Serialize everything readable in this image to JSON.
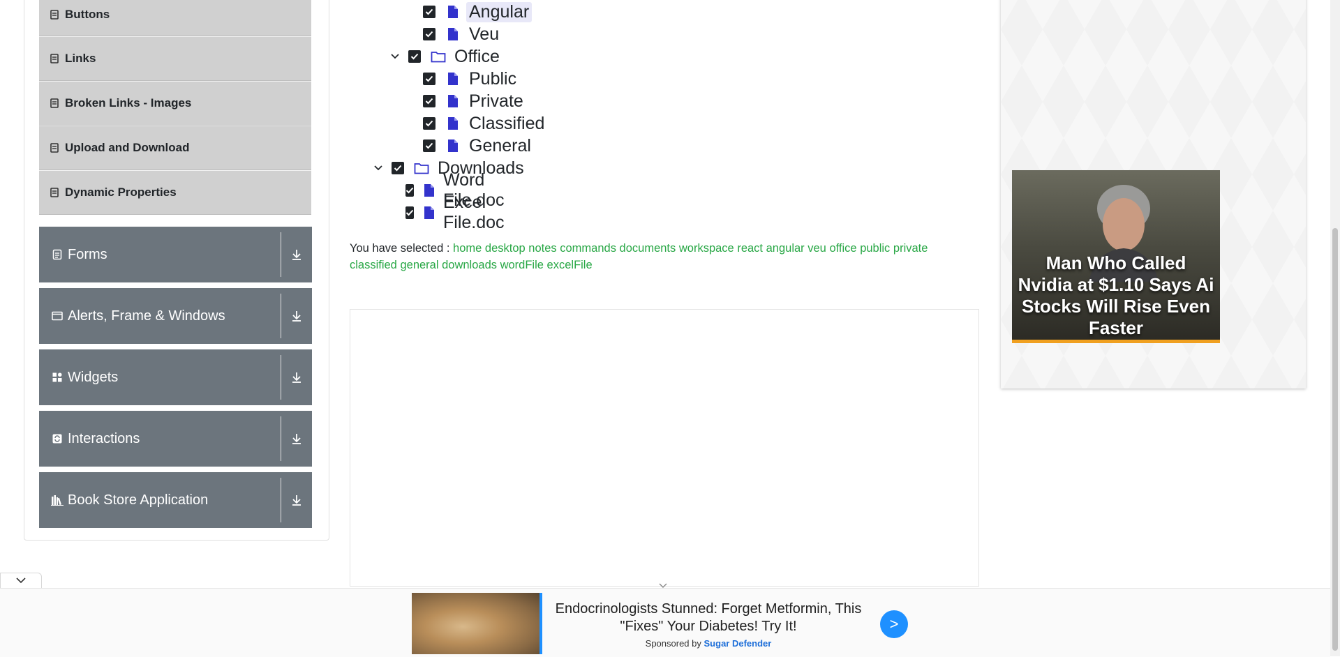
{
  "sidebar": {
    "sub_items": [
      {
        "label": "Buttons",
        "icon": "list-icon"
      },
      {
        "label": "Links",
        "icon": "list-icon"
      },
      {
        "label": "Broken Links - Images",
        "icon": "list-icon"
      },
      {
        "label": "Upload and Download",
        "icon": "list-icon"
      },
      {
        "label": "Dynamic Properties",
        "icon": "list-icon"
      }
    ],
    "groups": [
      {
        "label": "Forms",
        "icon": "document-icon"
      },
      {
        "label": "Alerts, Frame & Windows",
        "icon": "window-icon"
      },
      {
        "label": "Widgets",
        "icon": "grid-icon"
      },
      {
        "label": "Interactions",
        "icon": "interaction-icon"
      },
      {
        "label": "Book Store Application",
        "icon": "books-icon"
      }
    ]
  },
  "tree": {
    "nodes": [
      {
        "label": "Angular",
        "type": "file",
        "checked": true
      },
      {
        "label": "Veu",
        "type": "file",
        "checked": true
      },
      {
        "label": "Office",
        "type": "folder",
        "checked": true,
        "expanded": true
      },
      {
        "label": "Public",
        "type": "file",
        "checked": true
      },
      {
        "label": "Private",
        "type": "file",
        "checked": true
      },
      {
        "label": "Classified",
        "type": "file",
        "checked": true
      },
      {
        "label": "General",
        "type": "file",
        "checked": true
      },
      {
        "label": "Downloads",
        "type": "folder",
        "checked": true,
        "expanded": true
      },
      {
        "label": "Word File.doc",
        "type": "file",
        "checked": true
      },
      {
        "label": "Excel File.doc",
        "type": "file",
        "checked": true
      }
    ]
  },
  "result": {
    "prefix": "You have selected :",
    "selected": [
      "home",
      "desktop",
      "notes",
      "commands",
      "documents",
      "workspace",
      "react",
      "angular",
      "veu",
      "office",
      "public",
      "private",
      "classified",
      "general",
      "downloads",
      "wordFile",
      "excelFile"
    ]
  },
  "side_ad": {
    "headline": "Man Who Called Nvidia at $1.10 Says Ai Stocks Will Rise Even Faster"
  },
  "bottom_ad": {
    "text": "Endocrinologists Stunned: Forget Metformin, This \"Fixes\" Your Diabetes! Try It!",
    "sponsored_prefix": "Sponsored by",
    "sponsor": "Sugar Defender",
    "go_label": ">"
  },
  "colors": {
    "group_bg": "#6c757d",
    "sub_item_bg": "#d0d0d0",
    "selected_text": "#28a745",
    "file_icon": "#3333cc",
    "ad_button": "#1e90ff"
  }
}
